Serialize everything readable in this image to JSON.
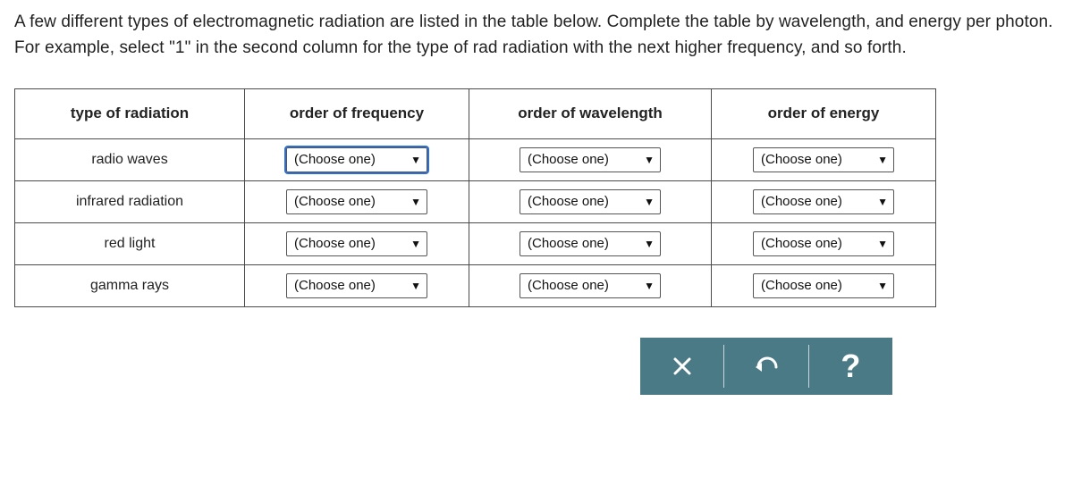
{
  "instructions": "A few different types of electromagnetic radiation are listed in the table below. Complete the table by wavelength, and energy per photon. For example, select \"1\" in the second column for the type of rad radiation with the next higher frequency, and so forth.",
  "table": {
    "headers": {
      "type": "type of radiation",
      "frequency": "order of frequency",
      "wavelength": "order of wavelength",
      "energy": "order of energy"
    },
    "placeholder": "(Choose one)",
    "rows": [
      {
        "label": "radio waves"
      },
      {
        "label": "infrared radiation"
      },
      {
        "label": "red light"
      },
      {
        "label": "gamma rays"
      }
    ]
  },
  "toolbar": {
    "close": "Close",
    "undo": "Undo",
    "help": "?"
  }
}
